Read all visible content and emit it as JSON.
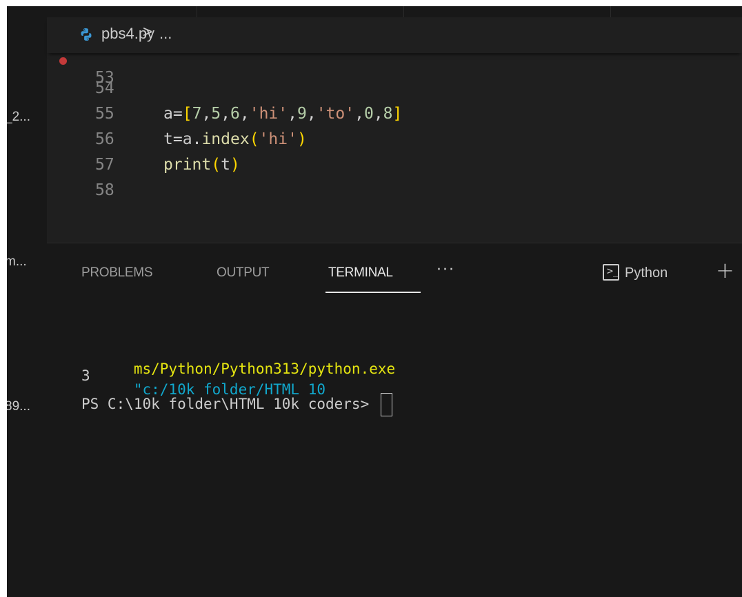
{
  "sidebar_fragments": [
    "_2...",
    "m...",
    "89..."
  ],
  "breadcrumb": {
    "file": "pbs4.py",
    "separator": ">",
    "more": "..."
  },
  "editor": {
    "partial_line_number": "53",
    "lines": [
      {
        "number": "54",
        "tokens": []
      },
      {
        "number": "55",
        "tokens": [
          {
            "t": "a",
            "c": "c-var"
          },
          {
            "t": "=",
            "c": "c-op"
          },
          {
            "t": "[",
            "c": "c-br"
          },
          {
            "t": "7",
            "c": "c-num"
          },
          {
            "t": ",",
            "c": "c-op"
          },
          {
            "t": "5",
            "c": "c-num"
          },
          {
            "t": ",",
            "c": "c-op"
          },
          {
            "t": "6",
            "c": "c-num"
          },
          {
            "t": ",",
            "c": "c-op"
          },
          {
            "t": "'hi'",
            "c": "c-str"
          },
          {
            "t": ",",
            "c": "c-op"
          },
          {
            "t": "9",
            "c": "c-num"
          },
          {
            "t": ",",
            "c": "c-op"
          },
          {
            "t": "'to'",
            "c": "c-str"
          },
          {
            "t": ",",
            "c": "c-op"
          },
          {
            "t": "0",
            "c": "c-num"
          },
          {
            "t": ",",
            "c": "c-op"
          },
          {
            "t": "8",
            "c": "c-num"
          },
          {
            "t": "]",
            "c": "c-br"
          }
        ]
      },
      {
        "number": "56",
        "tokens": [
          {
            "t": "t",
            "c": "c-var"
          },
          {
            "t": "=",
            "c": "c-op"
          },
          {
            "t": "a",
            "c": "c-var"
          },
          {
            "t": ".",
            "c": "c-op"
          },
          {
            "t": "index",
            "c": "c-fn"
          },
          {
            "t": "(",
            "c": "c-br"
          },
          {
            "t": "'hi'",
            "c": "c-str"
          },
          {
            "t": ")",
            "c": "c-br"
          }
        ]
      },
      {
        "number": "57",
        "tokens": [
          {
            "t": "print",
            "c": "c-fn"
          },
          {
            "t": "(",
            "c": "c-br"
          },
          {
            "t": "t",
            "c": "c-var"
          },
          {
            "t": ")",
            "c": "c-br"
          }
        ]
      },
      {
        "number": "58",
        "tokens": []
      }
    ]
  },
  "panel": {
    "tabs": [
      "PROBLEMS",
      "OUTPUT",
      "TERMINAL"
    ],
    "active_tab": "TERMINAL",
    "more": "···",
    "terminal_label": "Python",
    "add": "+"
  },
  "terminal": {
    "cmd_path": "ms/Python/Python313/python.exe",
    "cmd_arg": "\"c:/10k folder/HTML 10",
    "output": "3",
    "prompt": "PS C:\\10k folder\\HTML 10k coders> "
  },
  "colors": {
    "editor_bg": "#1f1f1f",
    "panel_bg": "#181818",
    "breakpoint": "#c43a3a"
  }
}
